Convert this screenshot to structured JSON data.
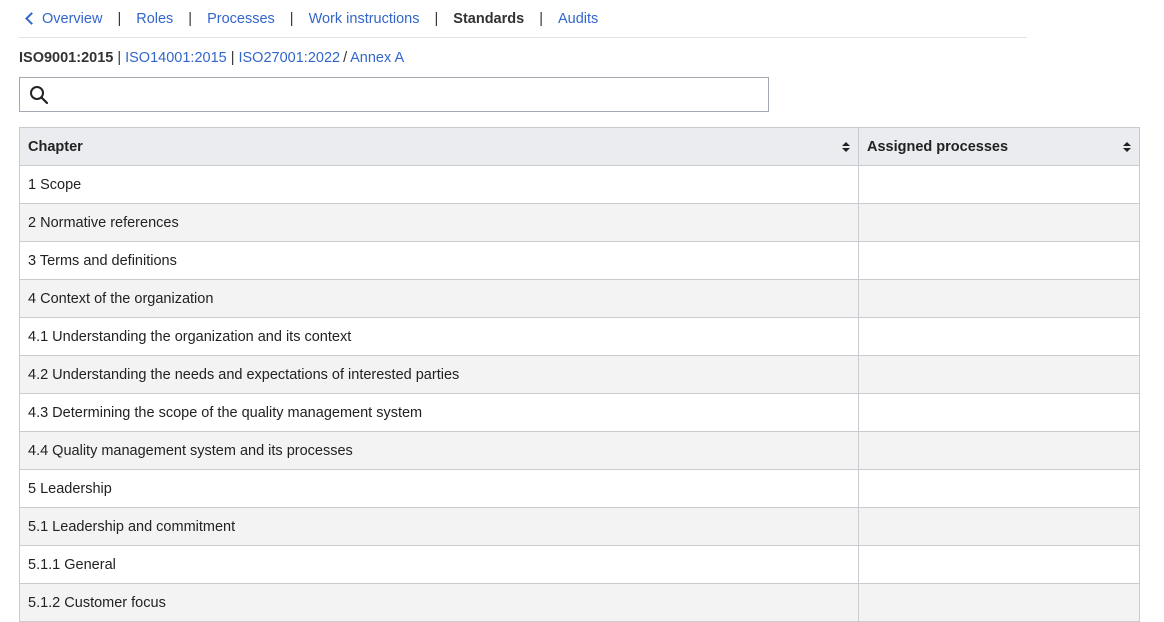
{
  "nav": {
    "back_label": "Overview",
    "items": [
      "Roles",
      "Processes",
      "Work instructions"
    ],
    "active": "Standards",
    "last": "Audits"
  },
  "standards": {
    "current": "ISO9001:2015",
    "others": [
      "ISO14001:2015",
      "ISO27001:2022"
    ],
    "annex": "Annex A"
  },
  "search": {
    "placeholder": "",
    "value": ""
  },
  "table": {
    "columns": [
      "Chapter",
      "Assigned processes"
    ],
    "rows": [
      [
        "1 Scope",
        ""
      ],
      [
        "2 Normative references",
        ""
      ],
      [
        "3 Terms and definitions",
        ""
      ],
      [
        "4 Context of the organization",
        ""
      ],
      [
        "4.1 Understanding the organization and its context",
        ""
      ],
      [
        "4.2 Understanding the needs and expectations of interested parties",
        ""
      ],
      [
        "4.3 Determining the scope of the quality management system",
        ""
      ],
      [
        "4.4 Quality management system and its processes",
        ""
      ],
      [
        "5 Leadership",
        ""
      ],
      [
        "5.1 Leadership and commitment",
        ""
      ],
      [
        "5.1.1 General",
        ""
      ],
      [
        "5.1.2 Customer focus",
        ""
      ]
    ]
  },
  "colors": {
    "link": "#3366cc",
    "header_bg": "#eaecf0",
    "stripe_bg": "#f3f3f3",
    "border": "#c8ccd1"
  },
  "icons": {
    "back": "chevron-left-icon",
    "search": "search-icon",
    "sort": "sort-icon"
  }
}
